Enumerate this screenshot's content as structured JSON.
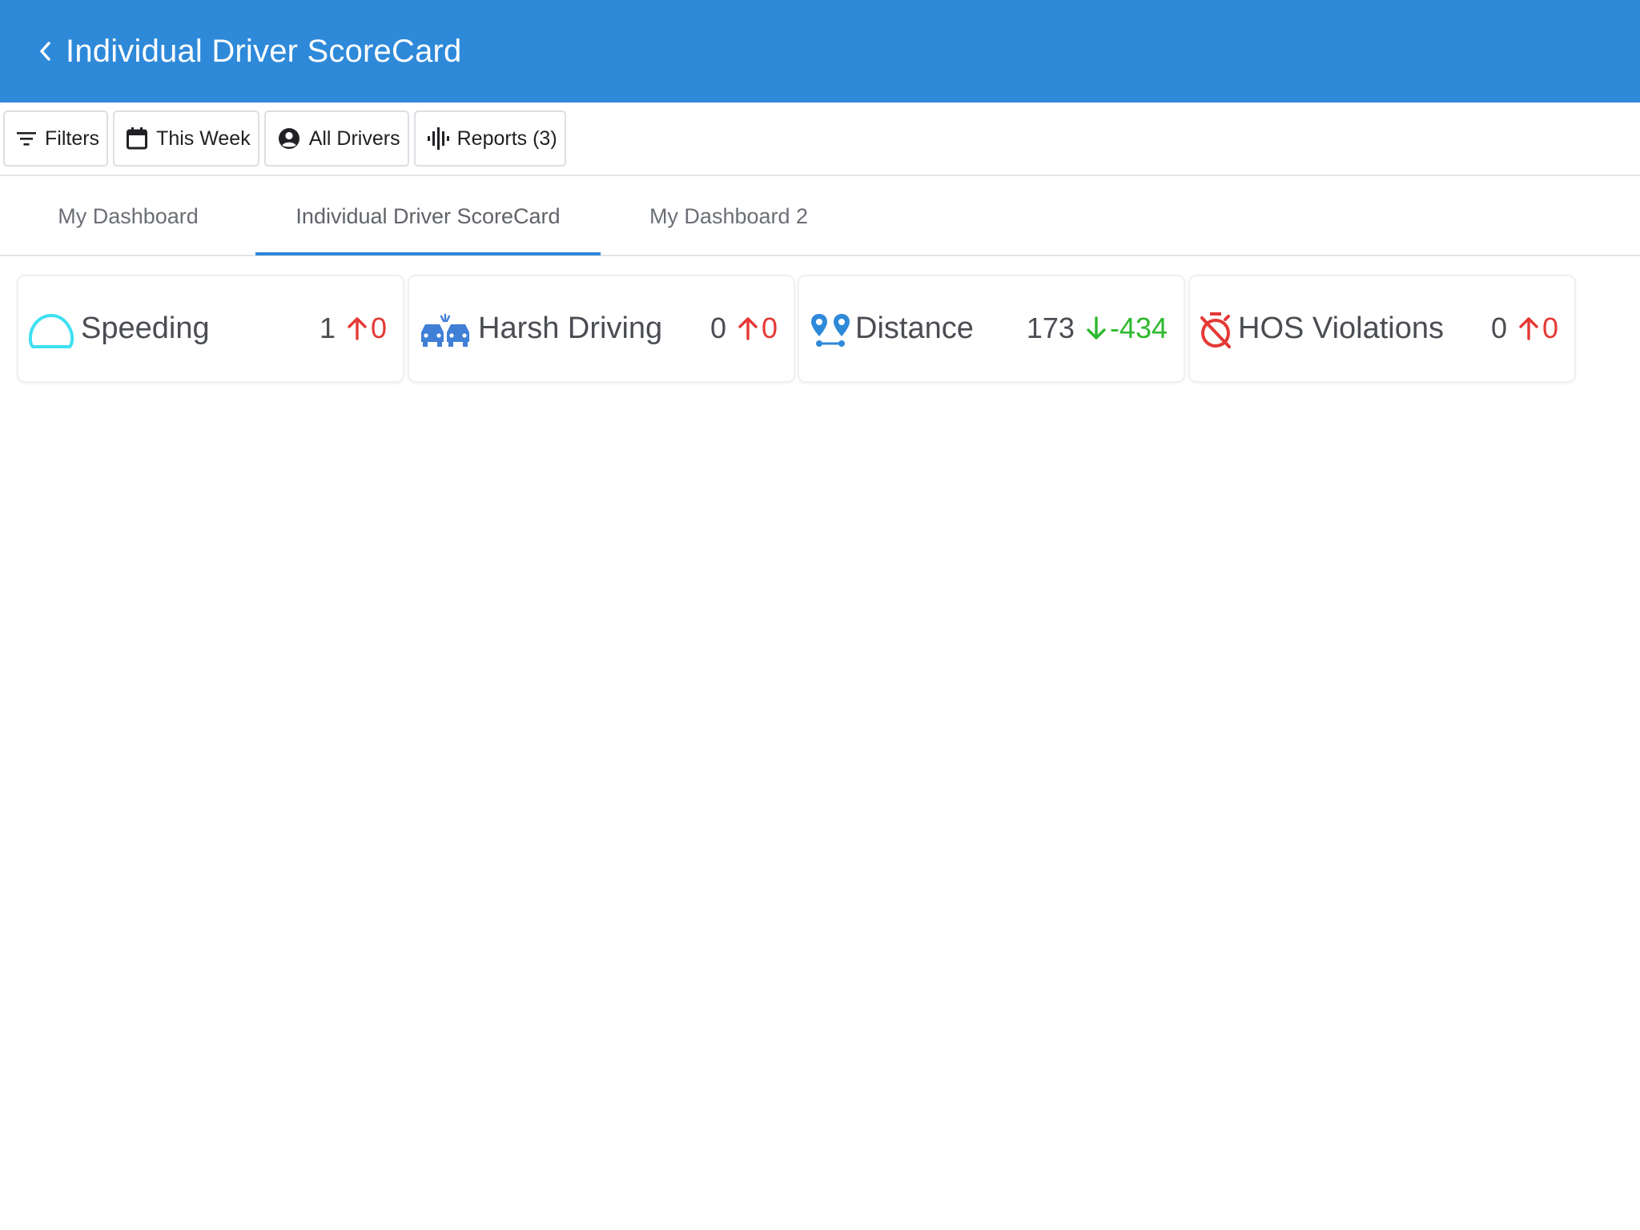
{
  "header": {
    "title": "Individual Driver ScoreCard",
    "background": "#2e89d9",
    "back_icon": "chevron-left-icon"
  },
  "toolbar": {
    "filters_label": "Filters",
    "date_label": "This Week",
    "drivers_label": "All Drivers",
    "reports_label": "Reports (3)"
  },
  "tabs": [
    {
      "label": "My Dashboard"
    },
    {
      "label": "Individual Driver ScoreCard",
      "active": true
    },
    {
      "label": "My Dashboard 2"
    }
  ],
  "kpis": [
    {
      "label": "Speeding",
      "value": "1",
      "delta": "0",
      "trend": "up",
      "icon": "speedometer-icon",
      "icon_color": "#3ee0f0",
      "delta_color": "#e53935"
    },
    {
      "label": "Harsh Driving",
      "value": "0",
      "delta": "0",
      "trend": "up",
      "icon": "car-collision-icon",
      "icon_color": "#3f7fd6",
      "delta_color": "#e53935"
    },
    {
      "label": "Distance",
      "value": "173",
      "delta": "-434",
      "trend": "down",
      "icon": "route-pins-icon",
      "icon_color": "#2e89d9",
      "delta_color": "#2eb82e"
    },
    {
      "label": "HOS Violations",
      "value": "0",
      "delta": "0",
      "trend": "up",
      "icon": "timer-off-icon",
      "icon_color": "#e53935",
      "delta_color": "#e53935"
    }
  ]
}
